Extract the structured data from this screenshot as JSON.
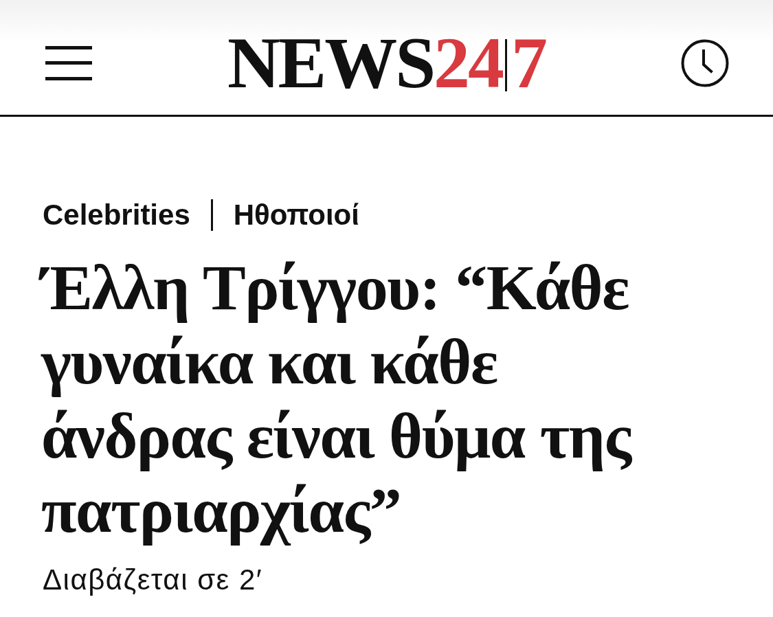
{
  "header": {
    "logo": {
      "parts": [
        {
          "text": "NEWS",
          "kind": "main"
        },
        {
          "text": "24",
          "kind": "accent"
        },
        {
          "text": "7",
          "kind": "accent"
        }
      ]
    }
  },
  "article": {
    "breadcrumbs": [
      "Celebrities",
      "Ηθοποιοί"
    ],
    "headline": "Έλλη Τρίγγου: “Κάθε γυναίκα και κάθε άνδρας είναι θύμα της πατριαρχίας”",
    "reading_time": "Διαβάζεται σε 2′"
  }
}
